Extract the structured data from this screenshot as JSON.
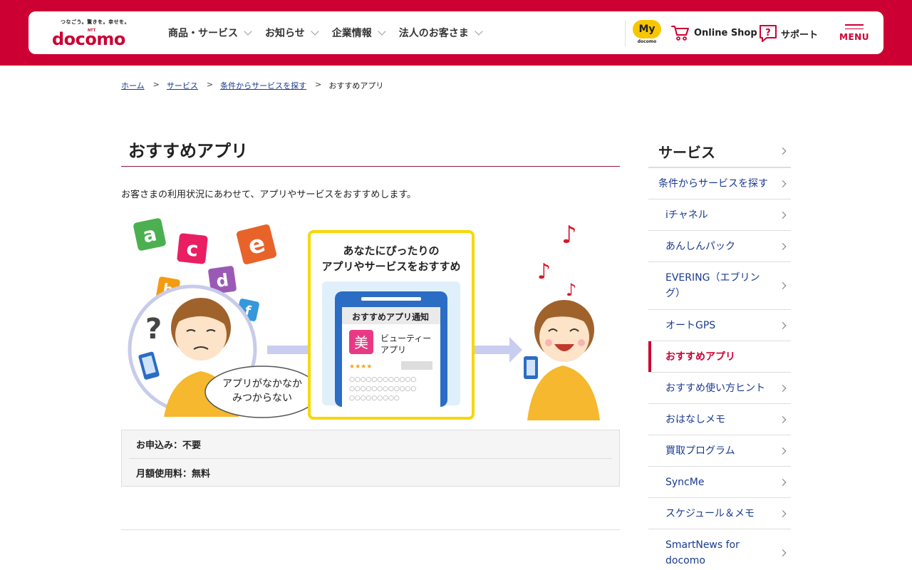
{
  "header": {
    "tagline": "つなごう。驚きを。幸せを。",
    "logo_ntt": "NTT",
    "logo_text": "docomo",
    "nav": [
      {
        "label": "商品・サービス"
      },
      {
        "label": "お知らせ"
      },
      {
        "label": "企業情報"
      },
      {
        "label": "法人のお客さま"
      }
    ],
    "my_label": "My",
    "my_sub": "docomo",
    "online_shop": "Online Shop",
    "support": "サポート",
    "menu": "MENU",
    "brand_color": "#cc0033"
  },
  "breadcrumb": {
    "items": [
      "ホーム",
      "サービス",
      "条件からサービスを探す"
    ],
    "current": "おすすめアプリ",
    "separator": ">"
  },
  "main": {
    "title": "おすすめアプリ",
    "lead": "お客さまの利用状況にあわせて、アプリやサービスをおすすめします。",
    "illustration": {
      "letters": [
        "a",
        "c",
        "e",
        "b",
        "d",
        "f"
      ],
      "question_mark": "?",
      "bubble_line1": "アプリがなかなか",
      "bubble_line2": "みつからない",
      "panel_line1": "あなたにぴったりの",
      "panel_line2": "アプリやサービスをおすすめ",
      "phone_header": "おすすめアプリ通知",
      "app_icon_char": "美",
      "app_name_line1": "ビューティー",
      "app_name_line2": "アプリ",
      "stars": "★★★★",
      "text_dots_1": "○○○○○○○○○○○○",
      "text_dots_2": "○○○○○○○○○○○○",
      "text_dots_3": "○○○○○○○○○",
      "notes": [
        "♪",
        "♪",
        "♪"
      ]
    },
    "info": [
      {
        "text": "お申込み：不要"
      },
      {
        "text": "月額使用料：無料"
      }
    ]
  },
  "sidenav": {
    "heading": "サービス",
    "items": [
      {
        "label": "条件からサービスを探す",
        "level": 1
      },
      {
        "label": "iチャネル",
        "level": 2
      },
      {
        "label": "あんしんパック",
        "level": 2
      },
      {
        "label": "EVERING（エブリング）",
        "level": 2
      },
      {
        "label": "オートGPS",
        "level": 2
      },
      {
        "label": "おすすめアプリ",
        "level": 2,
        "active": true
      },
      {
        "label": "おすすめ使い方ヒント",
        "level": 2
      },
      {
        "label": "おはなしメモ",
        "level": 2
      },
      {
        "label": "買取プログラム",
        "level": 2
      },
      {
        "label": "SyncMe",
        "level": 2
      },
      {
        "label": "スケジュール＆メモ",
        "level": 2
      },
      {
        "label": "SmartNews for docomo",
        "level": 2
      }
    ]
  }
}
